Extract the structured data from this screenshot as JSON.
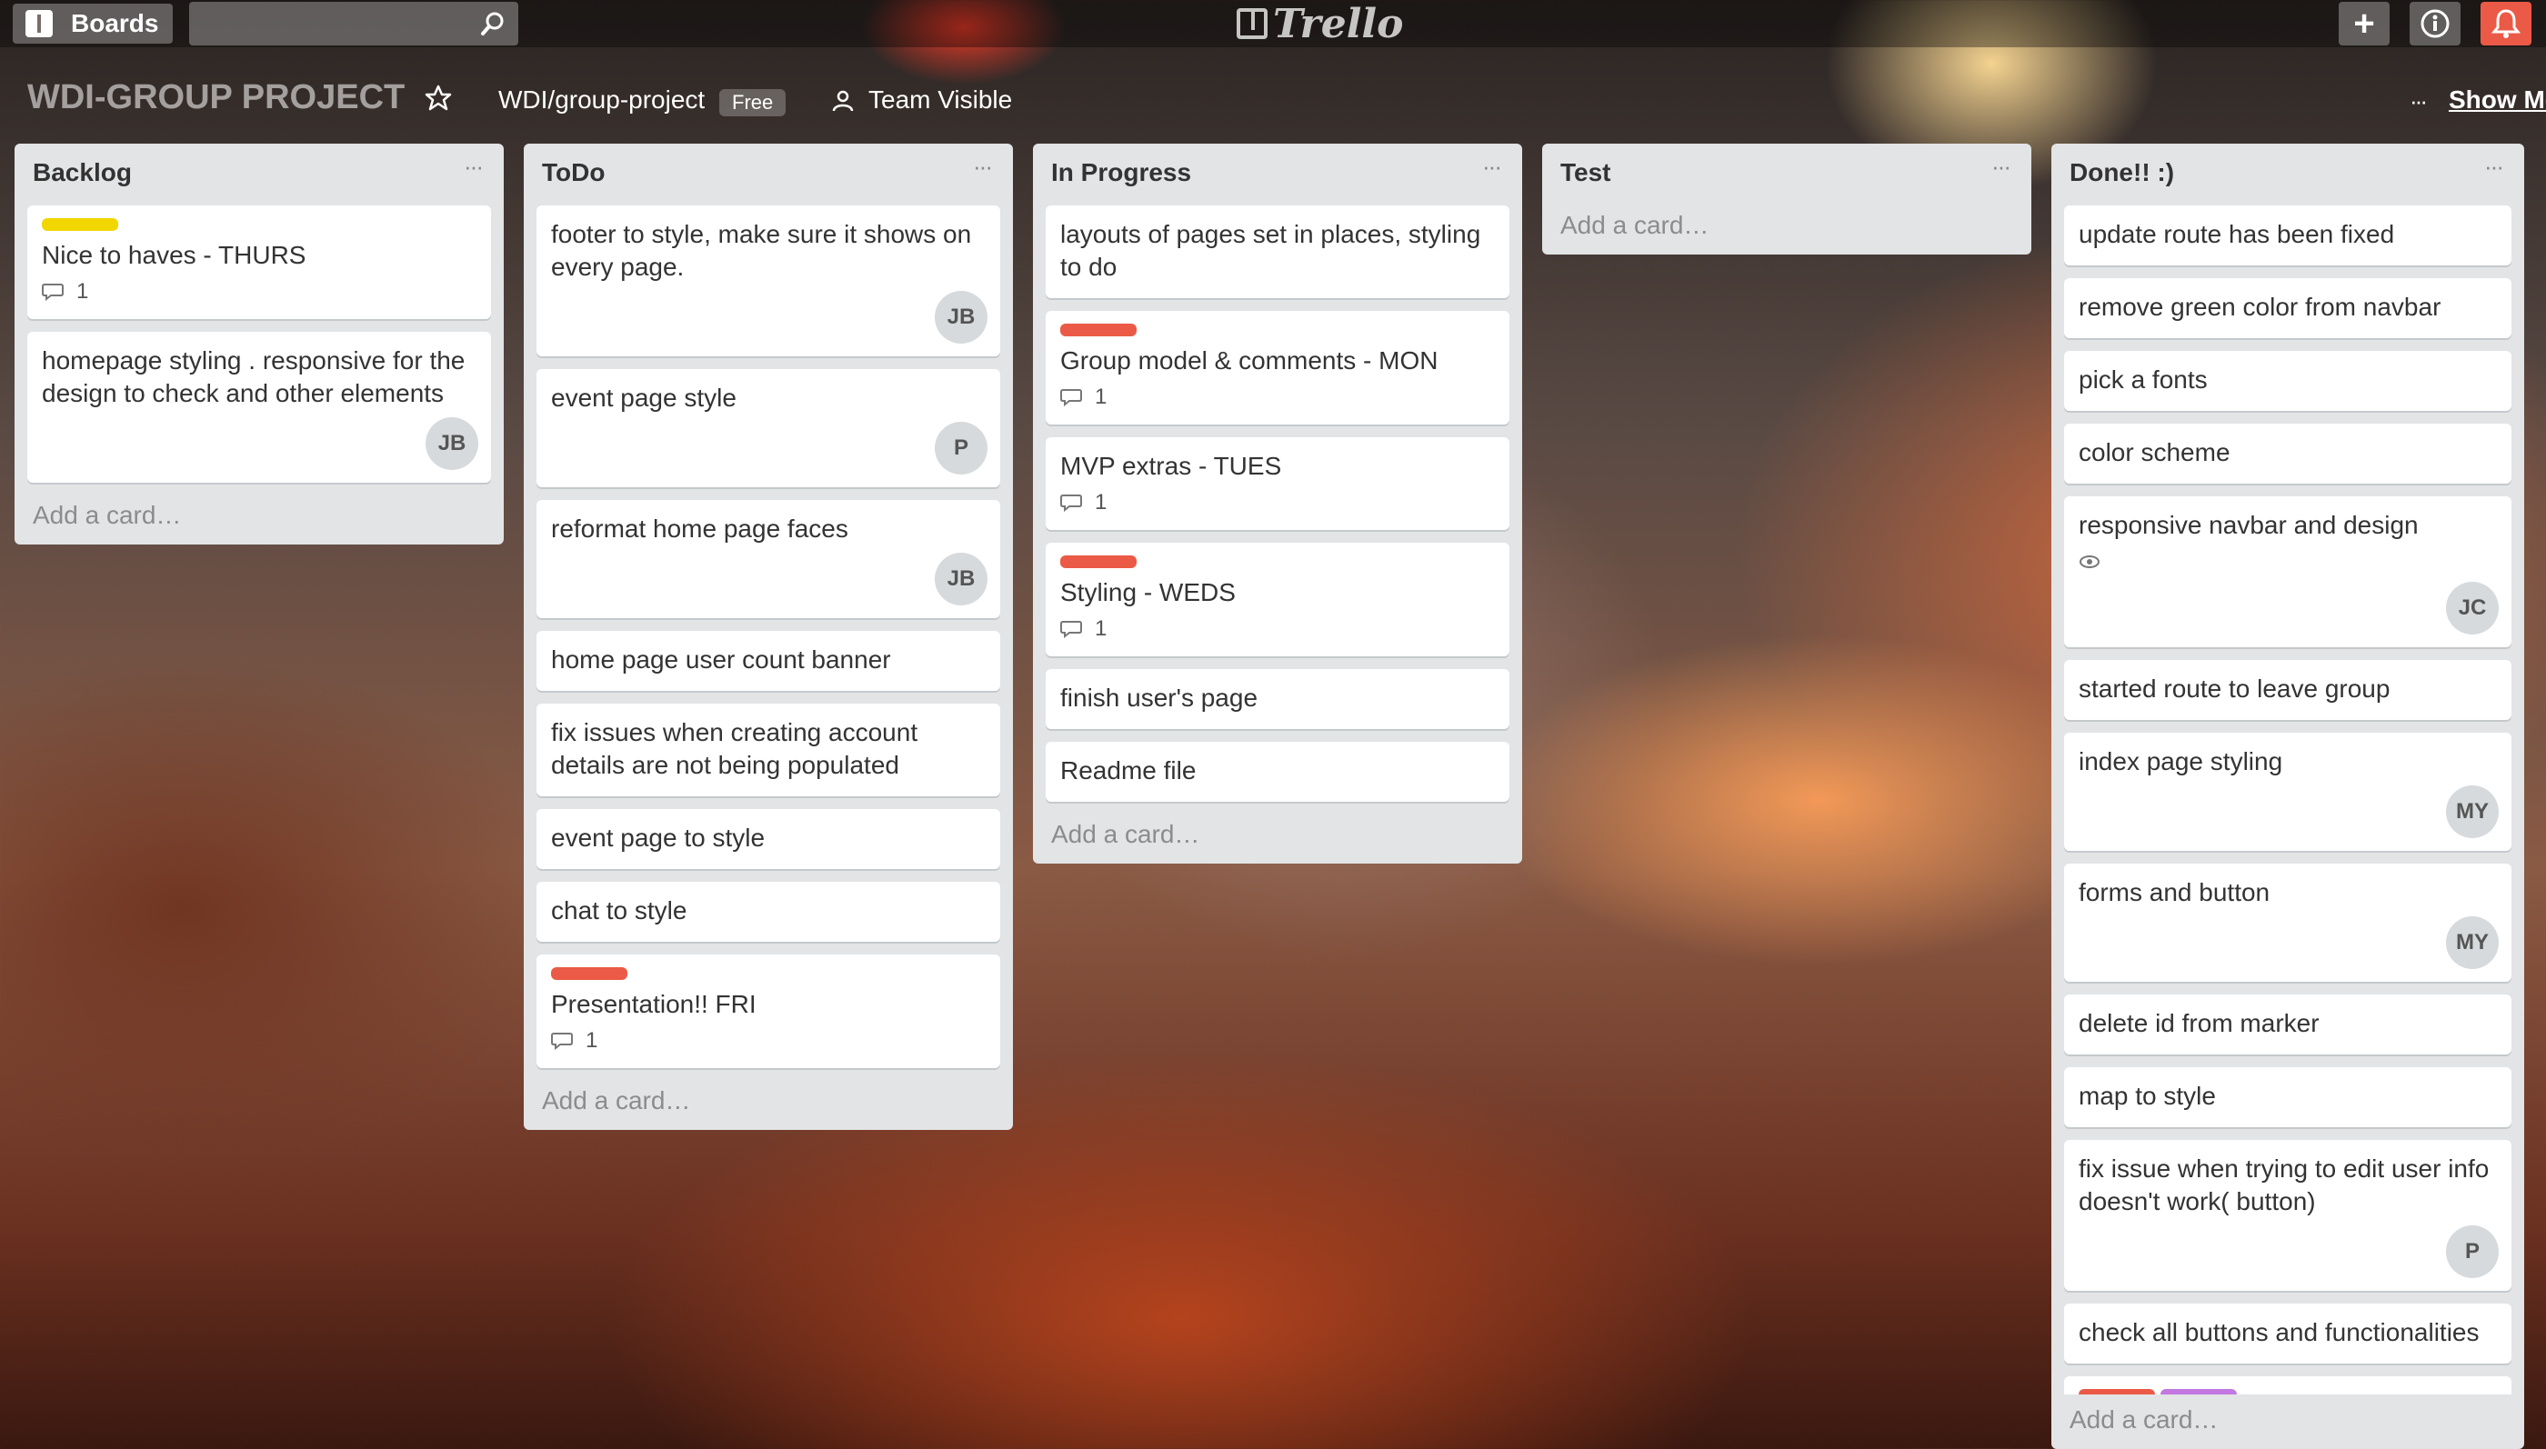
{
  "header": {
    "boards_label": "Boards",
    "search_placeholder": "",
    "logo_text": "Trello",
    "add_label": "+",
    "info_label": "i",
    "notif_label": ""
  },
  "board": {
    "title": "WDI-GROUP PROJECT",
    "org": "WDI/group-project",
    "plan": "Free",
    "visibility": "Team Visible",
    "show_menu": "Show Me",
    "menu_dots": "···"
  },
  "lists": [
    {
      "title": "Backlog",
      "add": "Add a card…",
      "cards": [
        {
          "text": "Nice to haves - THURS",
          "labels": [
            "#f2d600"
          ],
          "comments": "1",
          "avatar": ""
        },
        {
          "text": "homepage styling . responsive for the design to check and other elements",
          "labels": [],
          "comments": "",
          "avatar": "JB"
        }
      ]
    },
    {
      "title": "ToDo",
      "add": "Add a card…",
      "cards": [
        {
          "text": "footer to style, make sure it shows on every page.",
          "labels": [],
          "comments": "",
          "avatar": "JB"
        },
        {
          "text": "event page style",
          "labels": [],
          "comments": "",
          "avatar": "P"
        },
        {
          "text": "reformat home page faces",
          "labels": [],
          "comments": "",
          "avatar": "JB"
        },
        {
          "text": "home page user count banner",
          "labels": [],
          "comments": "",
          "avatar": ""
        },
        {
          "text": "fix issues when creating account details are not being populated",
          "labels": [],
          "comments": "",
          "avatar": ""
        },
        {
          "text": "event page to style",
          "labels": [],
          "comments": "",
          "avatar": ""
        },
        {
          "text": "chat to style",
          "labels": [],
          "comments": "",
          "avatar": ""
        },
        {
          "text": "Presentation!! FRI",
          "labels": [
            "#eb5a46"
          ],
          "comments": "1",
          "avatar": ""
        }
      ]
    },
    {
      "title": "In Progress",
      "add": "Add a card…",
      "cards": [
        {
          "text": "layouts of pages set in places, styling to do",
          "labels": [],
          "comments": "",
          "avatar": ""
        },
        {
          "text": "Group model & comments - MON",
          "labels": [
            "#eb5a46"
          ],
          "comments": "1",
          "avatar": ""
        },
        {
          "text": "MVP extras - TUES",
          "labels": [],
          "comments": "1",
          "avatar": ""
        },
        {
          "text": "Styling - WEDS",
          "labels": [
            "#eb5a46"
          ],
          "comments": "1",
          "avatar": ""
        },
        {
          "text": "finish user's page",
          "labels": [],
          "comments": "",
          "avatar": ""
        },
        {
          "text": "Readme file",
          "labels": [],
          "comments": "",
          "avatar": ""
        }
      ]
    },
    {
      "title": "Test",
      "add": "Add a card…",
      "cards": []
    },
    {
      "title": "Done!! :)",
      "add": "Add a card…",
      "cards": [
        {
          "text": "update route has been fixed",
          "labels": [],
          "comments": "",
          "avatar": ""
        },
        {
          "text": "remove green color from navbar",
          "labels": [],
          "comments": "",
          "avatar": ""
        },
        {
          "text": "pick a fonts",
          "labels": [],
          "comments": "",
          "avatar": ""
        },
        {
          "text": "color scheme",
          "labels": [],
          "comments": "",
          "avatar": ""
        },
        {
          "text": "responsive navbar and design",
          "labels": [],
          "comments": "",
          "avatar": "JC",
          "watch": true
        },
        {
          "text": "started route to leave group",
          "labels": [],
          "comments": "",
          "avatar": ""
        },
        {
          "text": "index page styling",
          "labels": [],
          "comments": "",
          "avatar": "MY"
        },
        {
          "text": "forms and button",
          "labels": [],
          "comments": "",
          "avatar": "MY"
        },
        {
          "text": "delete id from marker",
          "labels": [],
          "comments": "",
          "avatar": ""
        },
        {
          "text": "map to style",
          "labels": [],
          "comments": "",
          "avatar": ""
        },
        {
          "text": "fix issue when trying to edit user info doesn't work( button)",
          "labels": [],
          "comments": "",
          "avatar": "P"
        },
        {
          "text": "check all buttons and functionalities",
          "labels": [],
          "comments": "",
          "avatar": ""
        },
        {
          "text": "",
          "labels": [
            "#eb5a46",
            "#c377e0"
          ],
          "comments": "",
          "avatar": "",
          "partial": true
        }
      ]
    }
  ],
  "colors": {
    "list_bg": "#e2e4e6",
    "red_label": "#eb5a46",
    "yellow_label": "#f2d600",
    "purple_label": "#c377e0"
  }
}
